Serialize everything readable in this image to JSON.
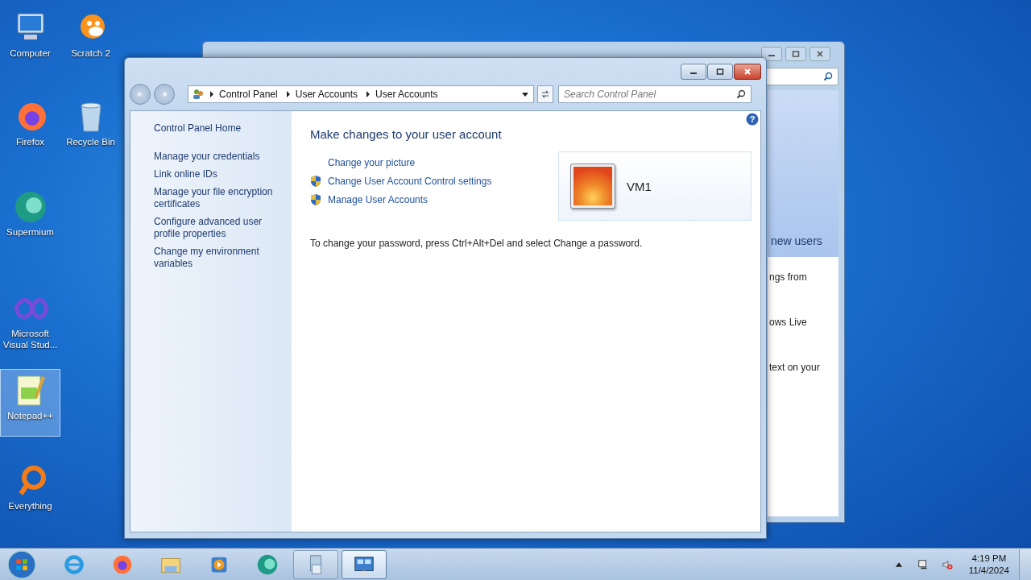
{
  "desktop_icons": [
    {
      "label": "Computer",
      "kind": "computer",
      "selected": false
    },
    {
      "label": "Scratch 2",
      "kind": "cat",
      "selected": false
    },
    {
      "label": "Firefox",
      "kind": "firefox",
      "selected": false
    },
    {
      "label": "Recycle Bin",
      "kind": "bin",
      "selected": false
    },
    {
      "label": "Supermium",
      "kind": "supermium",
      "selected": false
    },
    {
      "label": "Microsoft Visual Stud...",
      "kind": "vs",
      "selected": false
    },
    {
      "label": "Notepad++",
      "kind": "notepad",
      "selected": true
    },
    {
      "label": "Everything",
      "kind": "everything",
      "selected": false
    }
  ],
  "back_window": {
    "texts": [
      "new users",
      "ngs from",
      "ows Live",
      "text on your"
    ]
  },
  "window": {
    "breadcrumb": [
      "Control Panel",
      "User Accounts",
      "User Accounts"
    ],
    "search": {
      "placeholder": "Search Control Panel"
    },
    "sidebar": {
      "home": "Control Panel Home",
      "items": [
        "Manage your credentials",
        "Link online IDs",
        "Manage your file encryption certificates",
        "Configure advanced user profile properties",
        "Change my environment variables"
      ]
    },
    "help": "?",
    "heading": "Make changes to your user account",
    "tasks": [
      {
        "label": "Change your picture",
        "kind": "plain"
      },
      {
        "label": "Change User Account Control settings",
        "kind": "shield"
      },
      {
        "label": "Manage User Accounts",
        "kind": "shield"
      }
    ],
    "user": {
      "name": "VM1"
    },
    "note": "To change your password, press Ctrl+Alt+Del and select Change a password."
  },
  "taskbar": {
    "items": [
      {
        "kind": "ie",
        "selected": false,
        "running": false
      },
      {
        "kind": "firefox",
        "selected": false,
        "running": false
      },
      {
        "kind": "folder",
        "selected": false,
        "running": false
      },
      {
        "kind": "media",
        "selected": false,
        "running": false
      },
      {
        "kind": "supermium",
        "selected": false,
        "running": false
      },
      {
        "kind": "docs",
        "selected": false,
        "running": true
      },
      {
        "kind": "panel",
        "selected": true,
        "running": true
      }
    ],
    "time": "4:19 PM",
    "date": "11/4/2024"
  }
}
